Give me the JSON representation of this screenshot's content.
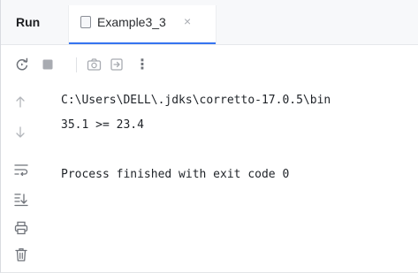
{
  "header": {
    "run_label": "Run",
    "tab": {
      "title": "Example3_3",
      "close_glyph": "×"
    }
  },
  "toolbar": {
    "icons": [
      "rerun-icon",
      "stop-icon",
      "camera-icon",
      "exit-icon",
      "more-icon"
    ],
    "more_glyph": "⋮"
  },
  "gutter": {
    "icons": [
      "arrow-up-icon",
      "arrow-down-icon",
      "soft-wrap-icon",
      "scroll-to-end-icon",
      "print-icon",
      "trash-icon"
    ]
  },
  "console": {
    "lines": [
      "C:\\Users\\DELL\\.jdks\\corretto-17.0.5\\bin",
      "35.1 >= 23.4",
      "",
      "Process finished with exit code 0"
    ]
  },
  "colors": {
    "accent": "#3574f0",
    "icon": "#6f737a",
    "text": "#1f2328"
  }
}
